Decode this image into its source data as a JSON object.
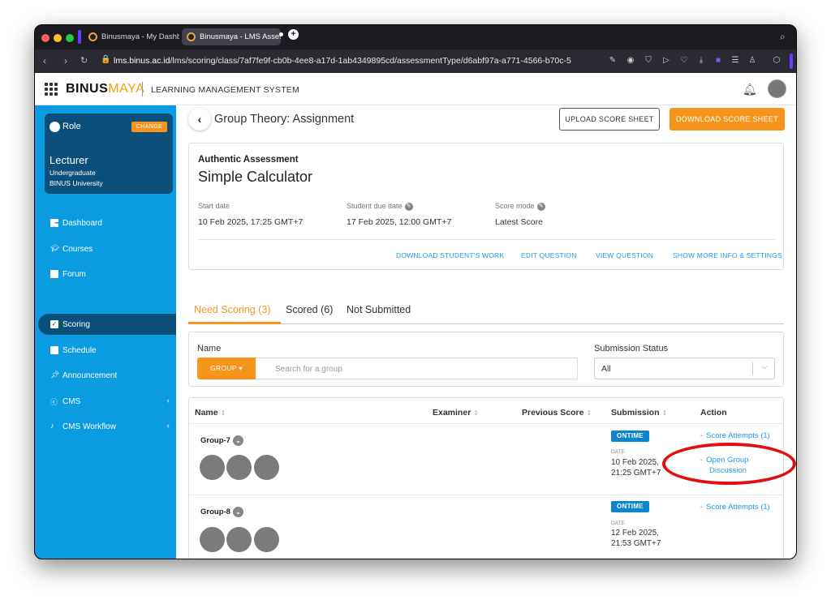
{
  "browser": {
    "tabs": [
      {
        "label": "Binusmaya - My Dashbo",
        "active": false
      },
      {
        "label": "Binusmaya - LMS Asses",
        "active": true
      }
    ],
    "url_host": "lms.binus.ac.id",
    "url_path": "/lms/scoring/class/7af7fe9f-cb0b-4ee8-a17d-1ab4349895cd/assessmentType/d6abf97a-a771-4566-b70c-5"
  },
  "header": {
    "logo_main": "BINUS",
    "logo_accent": "MAYA",
    "title": "LEARNING MANAGEMENT SYSTEM"
  },
  "sidebar": {
    "role_label": "Role",
    "change_label": "CHANGE",
    "role_name": "Lecturer",
    "role_level": "Undergraduate",
    "role_org": "BINUS University",
    "items": [
      {
        "label": "Dashboard",
        "icon": "dashboard-icon",
        "active": false
      },
      {
        "label": "Courses",
        "icon": "graduation-cap-icon",
        "active": false
      },
      {
        "label": "Forum",
        "icon": "chat-icon",
        "active": false
      },
      {
        "label": "Scoring",
        "icon": "checkbox-icon",
        "active": true
      },
      {
        "label": "Schedule",
        "icon": "calendar-icon",
        "active": false
      },
      {
        "label": "Announcement",
        "icon": "megaphone-icon",
        "active": false
      },
      {
        "label": "CMS",
        "icon": "cms-icon",
        "active": false,
        "expandable": true
      },
      {
        "label": "CMS Workflow",
        "icon": "workflow-icon",
        "active": false,
        "expandable": true
      }
    ]
  },
  "page": {
    "title": "Group Theory: Assignment",
    "upload_label": "UPLOAD SCORE SHEET",
    "download_label": "DOWNLOAD SCORE SHEET"
  },
  "assessment": {
    "type": "Authentic Assessment",
    "name": "Simple Calculator",
    "start_label": "Start date",
    "start_value": "10 Feb 2025, 17:25 GMT+7",
    "due_label": "Student due date",
    "due_value": "17 Feb 2025, 12:00 GMT+7",
    "mode_label": "Score mode",
    "mode_value": "Latest Score",
    "links": [
      "DOWNLOAD STUDENT'S WORK",
      "EDIT QUESTION",
      "VIEW QUESTION",
      "SHOW MORE INFO & SETTINGS"
    ]
  },
  "tabs": [
    {
      "label": "Need Scoring (3)",
      "active": true
    },
    {
      "label": "Scored (6)",
      "active": false
    },
    {
      "label": "Not Submitted",
      "active": false
    }
  ],
  "filter": {
    "name_label": "Name",
    "group_button": "GROUP",
    "search_placeholder": "Search for a group",
    "status_label": "Submission Status",
    "status_value": "All"
  },
  "table": {
    "columns": [
      "Name",
      "Examiner",
      "Previous Score",
      "Submission",
      "Action"
    ],
    "rows": [
      {
        "group": "Group-7",
        "badge": "ONTIME",
        "date_label": "DATE",
        "date_line1": "10 Feb 2025,",
        "date_line2": "21:25 GMT+7",
        "action1": "Score Attempts (1)",
        "action2_line1": "Open Group",
        "action2_line2": "Discussion"
      },
      {
        "group": "Group-8",
        "badge": "ONTIME",
        "date_label": "DATE",
        "date_line1": "12 Feb 2025,",
        "date_line2": "21:53 GMT+7",
        "action1": "Score Attempts (1)"
      }
    ]
  },
  "colors": {
    "sidebar": "#0a9be0",
    "sidebar_dark": "#0b4f7a",
    "accent": "#f7941d",
    "link": "#1f9be0",
    "highlight": "#e01010"
  }
}
